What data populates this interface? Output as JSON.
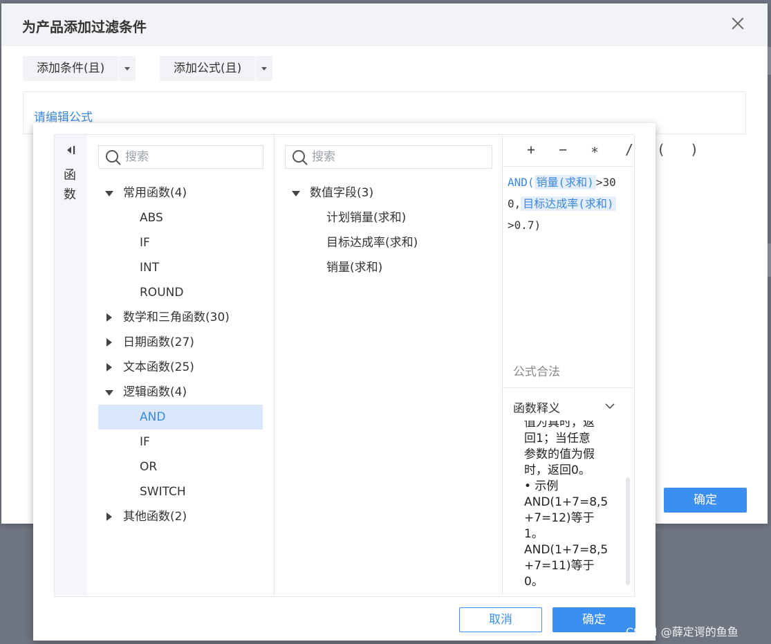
{
  "dialog": {
    "title": "为产品添加过滤条件",
    "add_condition_label": "添加条件(且)",
    "add_formula_label": "添加公式(且)",
    "formula_placeholder_link": "请编辑公式",
    "ok_label": "确定"
  },
  "editor": {
    "side_label": "函数",
    "function_search_placeholder": "搜索",
    "field_search_placeholder": "搜索",
    "function_tree": {
      "groups": [
        {
          "label": "常用函数(4)",
          "expanded": true,
          "items": [
            "ABS",
            "IF",
            "INT",
            "ROUND"
          ]
        },
        {
          "label": "数学和三角函数(30)",
          "expanded": false,
          "items": []
        },
        {
          "label": "日期函数(27)",
          "expanded": false,
          "items": []
        },
        {
          "label": "文本函数(25)",
          "expanded": false,
          "items": []
        },
        {
          "label": "逻辑函数(4)",
          "expanded": true,
          "items": [
            "AND",
            "IF",
            "OR",
            "SWITCH"
          ]
        },
        {
          "label": "其他函数(2)",
          "expanded": false,
          "items": []
        }
      ],
      "selected": "AND"
    },
    "field_tree": {
      "group_label": "数值字段(3)",
      "items": [
        "计划销量(求和)",
        "目标达成率(求和)",
        "销量(求和)"
      ]
    },
    "operators": [
      "+",
      "−",
      "∗",
      "/",
      "(",
      ")"
    ],
    "code": {
      "fn": "AND(",
      "token1": "销量(求和)",
      "seg1": ">30",
      "seg2": "0,",
      "token2": "目标达成率(求和)",
      "seg3": ">0.7)"
    },
    "status": "公式合法",
    "explain_title": "函数释义",
    "explain_lines": [
      "值为真时，返",
      "回1；当任意",
      "参数的值为假",
      "时，返回0。",
      "• 示例",
      "AND(1+7=8,5",
      "+7=12)等于",
      "1。",
      "AND(1+7=8,5",
      "+7=11)等于",
      "0。"
    ],
    "cancel_label": "取消",
    "ok_label": "确定"
  },
  "watermark": "CSDN @薛定谔的鱼鱼",
  "colors": {
    "accent": "#3b8ff0",
    "link": "#3a87e0",
    "selected_bg": "#dbe8fb"
  }
}
